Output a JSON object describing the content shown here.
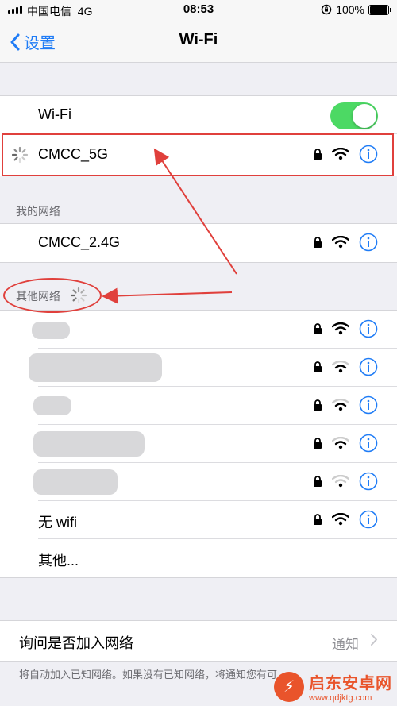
{
  "status_bar": {
    "carrier": "中国电信",
    "network": "4G",
    "time": "08:53",
    "battery": "100%"
  },
  "nav": {
    "back_label": "设置",
    "title": "Wi-Fi"
  },
  "wifi_toggle": {
    "label": "Wi-Fi",
    "on": true
  },
  "current": {
    "name": "CMCC_5G"
  },
  "my_networks": {
    "header": "我的网络",
    "items": [
      {
        "name": "CMCC_2.4G"
      }
    ]
  },
  "other_networks": {
    "header": "其他网络",
    "items": [
      {
        "name": ""
      },
      {
        "name": ""
      },
      {
        "name": ""
      },
      {
        "name": ""
      },
      {
        "name": ""
      },
      {
        "name": "无 wifi"
      }
    ],
    "other_label": "其他..."
  },
  "ask_join": {
    "label": "询问是否加入网络",
    "value": "通知"
  },
  "footer_text": "将自动加入已知网络。如果没有已知网络，将通知您有可",
  "watermark": {
    "title": "启东安卓网",
    "url": "www.qdjktg.com"
  },
  "colors": {
    "accent": "#1f7cf6",
    "toggle_on": "#4cd964",
    "annotation": "#e0403c"
  }
}
